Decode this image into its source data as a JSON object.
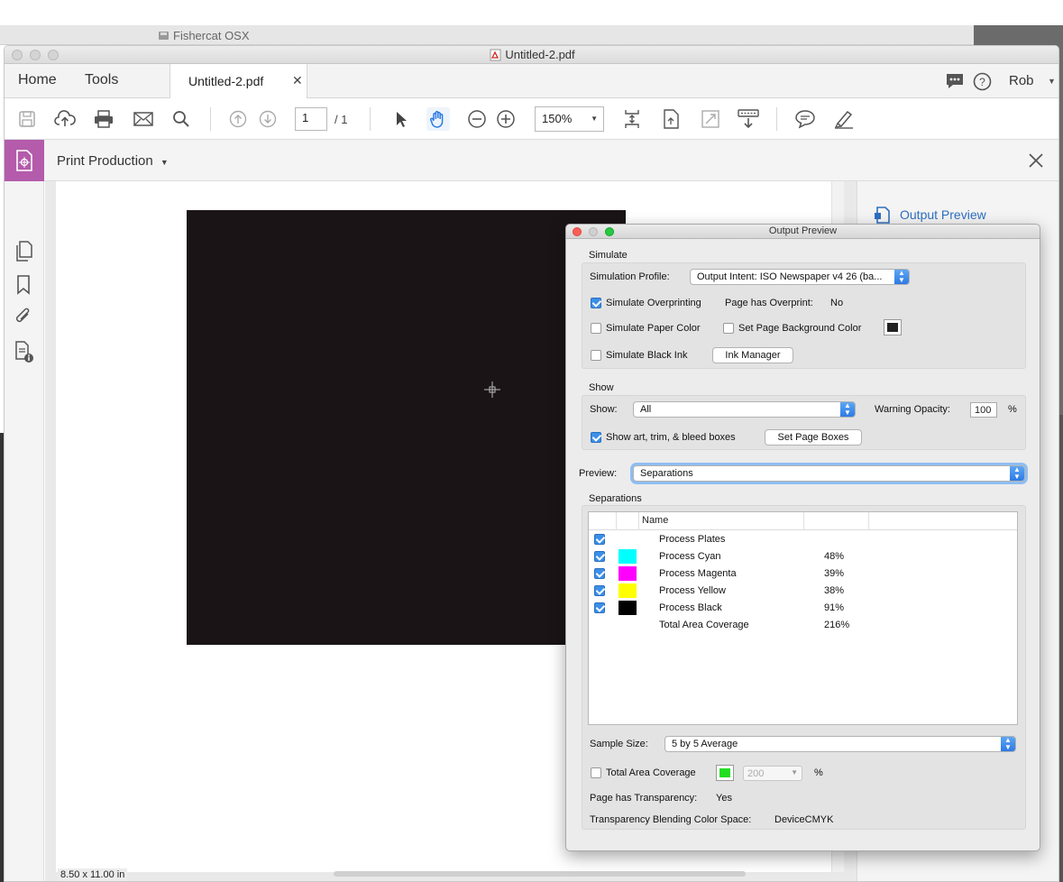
{
  "background_window": {
    "title": "Fishercat OSX"
  },
  "window": {
    "title": "Untitled-2.pdf"
  },
  "tabs": {
    "home": "Home",
    "tools": "Tools",
    "document": "Untitled-2.pdf",
    "user": "Rob"
  },
  "toolbar": {
    "page_current": "1",
    "page_total": "/ 1",
    "zoom": "150%"
  },
  "tool_panel": {
    "name": "Print Production"
  },
  "document": {
    "page_size": "8.50 x 11.00 in"
  },
  "right_pane": {
    "output_preview_link": "Output Preview"
  },
  "output_preview": {
    "title": "Output Preview",
    "simulate": {
      "heading": "Simulate",
      "profile_label": "Simulation Profile:",
      "profile_value": "Output Intent: ISO Newspaper v4 26 (ba...",
      "overprinting_label": "Simulate Overprinting",
      "overprinting_checked": true,
      "overprint_label": "Page has Overprint:",
      "overprint_value": "No",
      "paper_color_label": "Simulate Paper Color",
      "page_bg_label": "Set Page Background Color",
      "black_ink_label": "Simulate Black Ink",
      "ink_manager": "Ink Manager"
    },
    "show": {
      "heading": "Show",
      "show_label": "Show:",
      "show_value": "All",
      "warning_label": "Warning Opacity:",
      "warning_value": "100",
      "percent": "%",
      "boxes_label": "Show art, trim, & bleed boxes",
      "boxes_checked": true,
      "set_page_boxes": "Set Page Boxes"
    },
    "preview": {
      "label": "Preview:",
      "value": "Separations"
    },
    "separations": {
      "heading": "Separations",
      "column_name": "Name",
      "rows": [
        {
          "name": "Process Plates",
          "value": "",
          "color": "",
          "checked": true
        },
        {
          "name": "Process Cyan",
          "value": "48%",
          "color": "#00ffff",
          "checked": true
        },
        {
          "name": "Process Magenta",
          "value": "39%",
          "color": "#ff00ff",
          "checked": true
        },
        {
          "name": "Process Yellow",
          "value": "38%",
          "color": "#ffff00",
          "checked": true
        },
        {
          "name": "Process Black",
          "value": "91%",
          "color": "#000000",
          "checked": true
        },
        {
          "name": "Total Area Coverage",
          "value": "216%",
          "color": "",
          "checked": null
        }
      ]
    },
    "sample": {
      "label": "Sample Size:",
      "value": "5 by 5 Average"
    },
    "total_coverage": {
      "label": "Total Area Coverage",
      "value": "200",
      "percent": "%",
      "swatch_color": "#22dd22"
    },
    "transparency": {
      "label": "Page has Transparency:",
      "value": "Yes"
    },
    "blend_space": {
      "label": "Transparency Blending Color Space:",
      "value": "DeviceCMYK"
    }
  },
  "colors": {
    "accent": "#b45bab",
    "link": "#2d6fbf",
    "page_fill": "#1a1416"
  }
}
